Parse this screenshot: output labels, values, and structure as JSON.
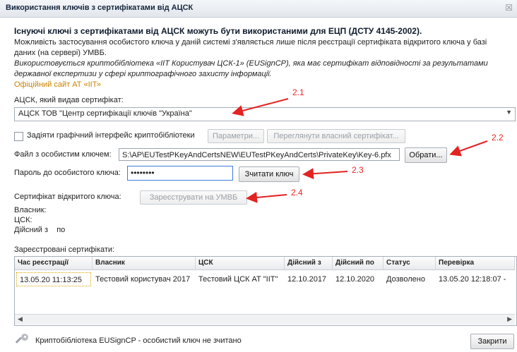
{
  "window": {
    "title": "Використання ключів з сертифікатами від АЦСК",
    "close_glyph": "☒"
  },
  "info": {
    "heading": "Існуючі ключі з сертифікатами від АЦСК можуть бути використаними для ЕЦП (ДСТУ 4145-2002).",
    "line1": "Можливість застосування особистого ключа у даній системі з'являється лише після реєстрації сертифіката відкритого ключа у базі",
    "line2": "даних (на сервері) УМВБ.",
    "line3": "Використовується криптобібліотека «ІІТ Користувач ЦСК-1» (EUSignCP), яка має сертифікат відповідності за результатами",
    "line4": "державної експертизи у сфері криптографічного захисту інформації.",
    "link": "Офіційний сайт АТ «ІІТ»"
  },
  "ca": {
    "label": "АЦСК, який видав сертифікат:",
    "selected": "АЦСК ТОВ \"Центр сертифікації ключів \"Україна\""
  },
  "crypto_ui": {
    "checkbox_label": "Задіяти графічний інтерфейс криптобібліотеки",
    "params_button": "Параметри...",
    "view_cert_button": "Переглянути власний сертифікат..."
  },
  "key_file": {
    "label": "Файл з особистим ключем:",
    "value": "S:\\AP\\EUTestPKeyAndCertsNEW\\EUTestPKeyAndCerts\\PrivateKey\\Key-6.pfx",
    "browse_button": "Обрати..."
  },
  "password": {
    "label": "Пароль до особистого ключа:",
    "value": "••••••••",
    "read_button": "Зчитати ключ"
  },
  "cert": {
    "label": "Сертифікат відкритого ключа:",
    "register_button": "Зареєструвати на УМВБ",
    "owner_label": "Власник:",
    "csk_label": "ЦСК:",
    "valid_label": "Дійсний з    по"
  },
  "registered": {
    "label": "Зареєстровані сертифікати:",
    "columns": [
      "Час реєстрації",
      "Власник",
      "ЦСК",
      "Дійсний з",
      "Дійсний по",
      "Статус",
      "Перевірка"
    ],
    "rows": [
      [
        "13.05.20 11:13:25",
        "Тестовий користувач 2017",
        "Тестовий ЦСК АТ \"ІІТ\"",
        "12.10.2017",
        "12.10.2020",
        "Дозволено",
        "13.05.20 12:18:07 -"
      ]
    ]
  },
  "footer": {
    "status": "Криптобібліотека EUSignCP - особистий ключ не зчитано",
    "close_button": "Закрити",
    "icon": "key-icon"
  },
  "annotations": {
    "a1": "2.1",
    "a2": "2.2",
    "a3": "2.3",
    "a4": "2.4",
    "color": "#e32222"
  }
}
